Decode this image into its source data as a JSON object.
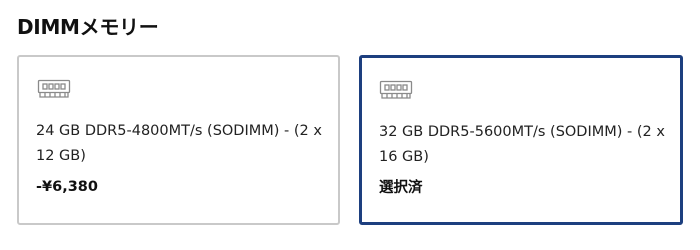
{
  "section": {
    "title": "DIMMメモリー"
  },
  "options": [
    {
      "icon": "memory-module-icon",
      "description": "24 GB DDR5-4800MT/s (SODIMM) - (2 x 12 GB)",
      "status": "-¥6,380",
      "selected": false
    },
    {
      "icon": "memory-module-icon",
      "description": "32 GB DDR5-5600MT/s (SODIMM) - (2 x 16 GB)",
      "status": "選択済",
      "selected": true
    }
  ],
  "colors": {
    "selected_border": "#1d3f7f",
    "default_border": "#c9c9c9",
    "icon_stroke": "#8a8a8a"
  }
}
